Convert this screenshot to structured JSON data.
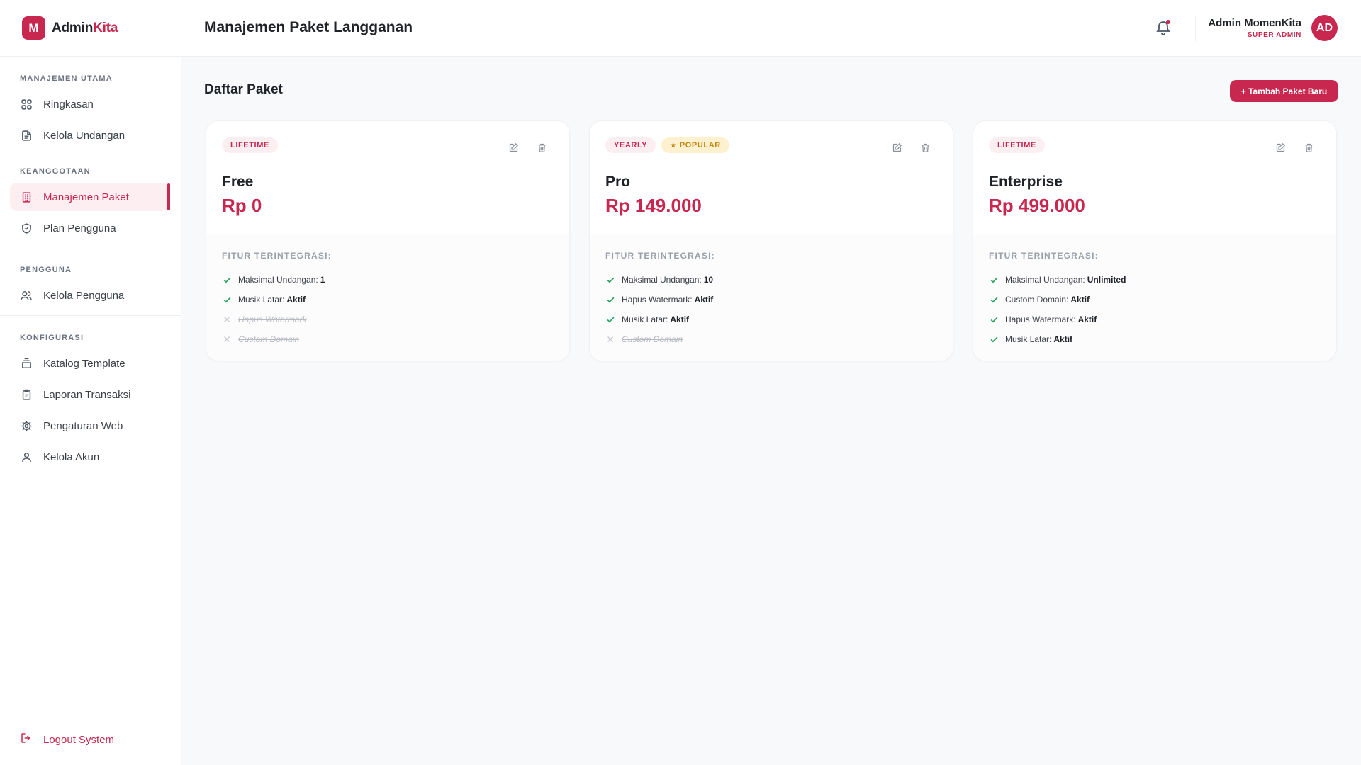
{
  "brand": {
    "logo_letter": "M",
    "name_part1": "Admin",
    "name_part2": "Kita",
    "accent": "#c8284f"
  },
  "sidebar": {
    "sections": [
      {
        "label": "MANAJEMEN UTAMA"
      },
      {
        "label": "KEANGGOTAAN"
      },
      {
        "label": "PENGGUNA"
      },
      {
        "label": "KONFIGURASI"
      }
    ],
    "items": [
      {
        "label": "Ringkasan",
        "icon": "grid-icon"
      },
      {
        "label": "Kelola Undangan",
        "icon": "document-icon"
      },
      {
        "label": "Manajemen Paket",
        "icon": "building-icon",
        "active": true
      },
      {
        "label": "Plan Pengguna",
        "icon": "shield-icon"
      },
      {
        "label": "Kelola Pengguna",
        "icon": "users-icon"
      },
      {
        "label": "Katalog Template",
        "icon": "layers-icon"
      },
      {
        "label": "Laporan Transaksi",
        "icon": "clipboard-icon"
      },
      {
        "label": "Pengaturan Web",
        "icon": "gear-icon"
      },
      {
        "label": "Kelola Akun",
        "icon": "user-icon"
      }
    ],
    "logout_label": "Logout System"
  },
  "header": {
    "title": "Manajemen Paket Langganan",
    "user_name": "Admin MomenKita",
    "user_role": "SUPER ADMIN",
    "avatar_initials": "AD"
  },
  "main": {
    "section_title": "Daftar Paket",
    "add_button_label": "+ Tambah Paket Baru",
    "features_title": "FITUR TERINTEGRASI:",
    "plans": [
      {
        "badge": "LIFETIME",
        "name": "Free",
        "price": "Rp 0",
        "features": [
          {
            "label": "Maksimal Undangan:",
            "value": "1",
            "enabled": true
          },
          {
            "label": "Musik Latar:",
            "value": "Aktif",
            "enabled": true
          },
          {
            "label": "Hapus Watermark",
            "value": "",
            "enabled": false
          },
          {
            "label": "Custom Domain",
            "value": "",
            "enabled": false
          }
        ]
      },
      {
        "badge": "YEARLY",
        "popular_badge": "POPULAR",
        "name": "Pro",
        "price": "Rp 149.000",
        "features": [
          {
            "label": "Maksimal Undangan:",
            "value": "10",
            "enabled": true
          },
          {
            "label": "Hapus Watermark:",
            "value": "Aktif",
            "enabled": true
          },
          {
            "label": "Musik Latar:",
            "value": "Aktif",
            "enabled": true
          },
          {
            "label": "Custom Domain",
            "value": "",
            "enabled": false
          }
        ]
      },
      {
        "badge": "LIFETIME",
        "name": "Enterprise",
        "price": "Rp 499.000",
        "features": [
          {
            "label": "Maksimal Undangan:",
            "value": "Unlimited",
            "enabled": true
          },
          {
            "label": "Custom Domain:",
            "value": "Aktif",
            "enabled": true
          },
          {
            "label": "Hapus Watermark:",
            "value": "Aktif",
            "enabled": true
          },
          {
            "label": "Musik Latar:",
            "value": "Aktif",
            "enabled": true
          }
        ]
      }
    ]
  }
}
